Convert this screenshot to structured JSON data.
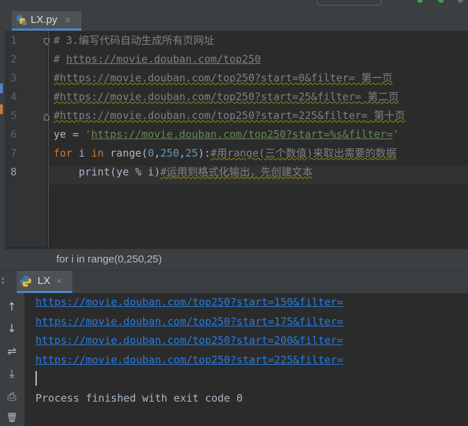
{
  "colors": {
    "background": "#2b2b2b",
    "gutter": "#313335",
    "chrome": "#3c3f41",
    "keyword": "#cc7832",
    "number": "#6897bb",
    "string": "#6a8759",
    "comment": "#808080",
    "link": "#287bde",
    "tab_underline": "#4a88c7"
  },
  "editor_tab": {
    "filename": "LX.py",
    "close_glyph": "×",
    "icon": "python-file-icon"
  },
  "editor": {
    "line_numbers": [
      "1",
      "2",
      "3",
      "4",
      "5",
      "6",
      "7",
      "8"
    ],
    "lines": [
      {
        "parts": [
          "# 3.编写代码自动生成所有页网址"
        ]
      },
      {
        "parts": [
          "# ",
          "https://movie.douban.com/top250"
        ]
      },
      {
        "parts": [
          "#https://movie.douban.com/top250?start=0&filter=",
          " 第一页"
        ]
      },
      {
        "parts": [
          "#https://movie.douban.com/top250?start=25&filter=",
          " 第二页"
        ]
      },
      {
        "parts": [
          "#https://movie.douban.com/top250?start=225&filter=",
          " 第十页"
        ]
      },
      {
        "parts": [
          "ye",
          " = ",
          "'",
          "https://movie.douban.com/top250?start=%s&filter=",
          "'"
        ]
      },
      {
        "parts": [
          "for",
          " i ",
          "in",
          " range(",
          "0",
          ",",
          "250",
          ",",
          "25",
          "):",
          "#用range(三个数值)来取出需要的数据"
        ]
      },
      {
        "parts": [
          "    print(ye % i)",
          "#运用到格式化输出，先创建文本"
        ]
      }
    ]
  },
  "status": {
    "breadcrumb": "for i in range(0,250,25)"
  },
  "run_panel": {
    "prefix": ":",
    "tab_label": "LX",
    "close_glyph": "×",
    "output_links": [
      "https://movie.douban.com/top250?start=150&filter=",
      "https://movie.douban.com/top250?start=175&filter=",
      "https://movie.douban.com/top250?start=200&filter=",
      "https://movie.douban.com/top250?start=225&filter="
    ],
    "exit_message": "Process finished with exit code 0",
    "tools": [
      {
        "name": "scroll-up-icon",
        "glyph": "↑"
      },
      {
        "name": "scroll-down-icon",
        "glyph": "↓"
      },
      {
        "name": "soft-wrap-icon",
        "glyph": "⇌"
      },
      {
        "name": "scroll-to-end-icon",
        "glyph": "⤓"
      },
      {
        "name": "print-icon",
        "glyph": "⎙"
      },
      {
        "name": "delete-icon",
        "glyph": "🗑"
      }
    ]
  }
}
